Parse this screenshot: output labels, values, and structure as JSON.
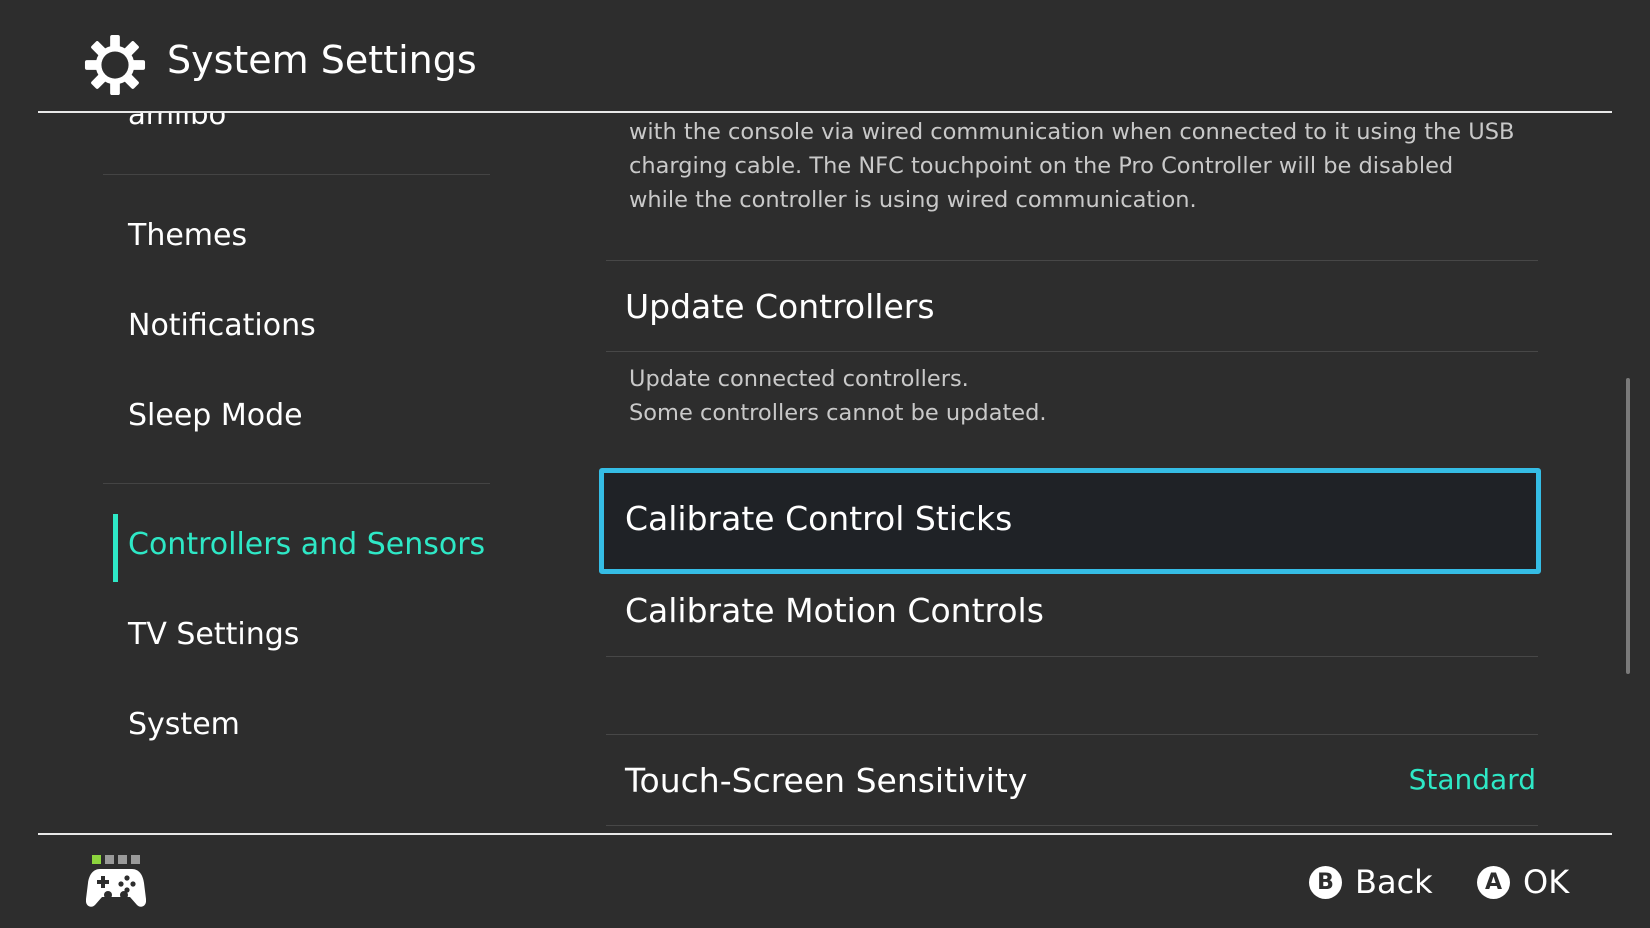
{
  "header": {
    "title": "System Settings",
    "icon": "gear-icon"
  },
  "sidebar": {
    "partial_item": "amiibo",
    "items": [
      {
        "label": "Themes"
      },
      {
        "label": "Notifications"
      },
      {
        "label": "Sleep Mode"
      },
      {
        "label": "Controllers and Sensors",
        "active": true
      },
      {
        "label": "TV Settings"
      },
      {
        "label": "System"
      }
    ]
  },
  "content": {
    "pro_controller_desc": [
      "with the console via wired communication when connected to it using the USB",
      "charging cable. The NFC touchpoint on the Pro Controller will be disabled",
      "while the controller is using wired communication."
    ],
    "update_controllers": {
      "title": "Update Controllers",
      "desc": [
        "Update connected controllers.",
        "Some controllers cannot be updated."
      ]
    },
    "calibrate_sticks": {
      "title": "Calibrate Control Sticks",
      "selected": true
    },
    "calibrate_motion": {
      "title": "Calibrate Motion Controls"
    },
    "touch_screen": {
      "title": "Touch-Screen Sensitivity",
      "value": "Standard"
    }
  },
  "footer": {
    "player_indicator_active": 1,
    "controller_icon": "controller-icon",
    "back": {
      "button": "B",
      "label": "Back"
    },
    "ok": {
      "button": "A",
      "label": "OK"
    }
  },
  "colors": {
    "accent": "#2ee8c6",
    "selection": "#35bde5",
    "background": "#2d2d2d"
  }
}
